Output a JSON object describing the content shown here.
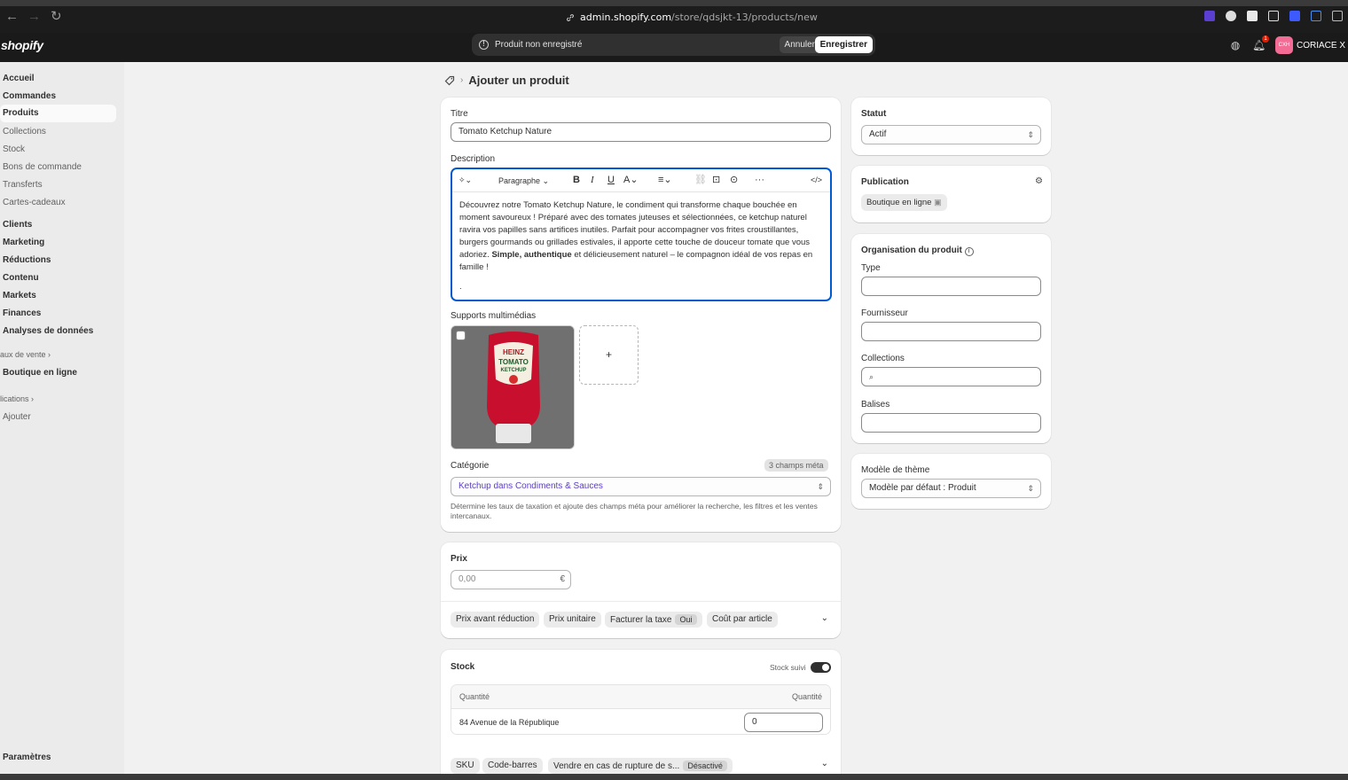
{
  "browser": {
    "url_host": "admin.shopify.com",
    "url_path": "/store/qdsjkt-13/products/new"
  },
  "topbar": {
    "logo": "shopify",
    "unsaved_text": "Produit non enregistré",
    "cancel_label": "Annuler",
    "save_label": "Enregistrer",
    "notification_count": "1",
    "store_initials": "CXH",
    "store_name": "CORIACE X H"
  },
  "sidebar": {
    "items": [
      {
        "label": "Accueil"
      },
      {
        "label": "Commandes"
      },
      {
        "label": "Produits"
      },
      {
        "label": "Collections"
      },
      {
        "label": "Stock"
      },
      {
        "label": "Bons de commande"
      },
      {
        "label": "Transferts"
      },
      {
        "label": "Cartes-cadeaux"
      },
      {
        "label": "Clients"
      },
      {
        "label": "Marketing"
      },
      {
        "label": "Réductions"
      },
      {
        "label": "Contenu"
      },
      {
        "label": "Markets"
      },
      {
        "label": "Finances"
      },
      {
        "label": "Analyses de données"
      }
    ],
    "sales_channels_label": "aux de vente",
    "online_store": "Boutique en ligne",
    "apps_label": "lications",
    "add_label": "Ajouter",
    "settings": "Paramètres"
  },
  "page": {
    "title": "Ajouter un produit",
    "title_label": "Titre",
    "title_value": "Tomato Ketchup Nature",
    "description_label": "Description",
    "paragraph_select": "Paragraphe",
    "description": {
      "part1": "Découvrez notre Tomato Ketchup Nature, le condiment qui transforme chaque bouchée en moment savoureux ! Préparé avec des tomates juteuses et sélectionnées, ce ketchup naturel ravira vos papilles sans artifices inutiles. Parfait pour accompagner vos frites croustillantes, burgers gourmands ou grillades estivales, il apporte cette touche de douceur tomate que vous adoriez. ",
      "bold": "Simple, authentique",
      "part2": " et délicieusement naturel – le compagnon idéal de vos repas en famille !",
      "trailing": "."
    },
    "media_label": "Supports multimédias",
    "bottle_texts": {
      "brand": "HEINZ",
      "line1": "TOMATO",
      "line2": "KETCHUP"
    },
    "add_media": "+",
    "category_label": "Catégorie",
    "category_badge": "3 champs méta",
    "category_value_main": "Ketchup",
    "category_value_rest": " dans Condiments & Sauces",
    "category_help": "Détermine les taux de taxation et ajoute des champs méta pour améliorer la recherche, les filtres et les ventes intercanaux.",
    "price_label": "Prix",
    "price_placeholder": "0,00",
    "currency": "€",
    "price_pills": [
      "Prix avant réduction",
      "Prix unitaire",
      "Facturer la taxe",
      "Coût par article"
    ],
    "tax_badge": "Oui",
    "stock_label": "Stock",
    "stock_tracked": "Stock suivi",
    "stock_tracked_on": true,
    "qty_header_left": "Quantité",
    "qty_header_right": "Quantité",
    "location": "84 Avenue de la République",
    "location_qty": "0",
    "stock_pills": [
      "SKU",
      "Code-barres",
      "Vendre en cas de rupture de s..."
    ],
    "oos_badge": "Désactivé"
  },
  "right": {
    "status_label": "Statut",
    "status_value": "Actif",
    "publication_label": "Publication",
    "publication_channel": "Boutique en ligne",
    "org_label": "Organisation du produit",
    "type_label": "Type",
    "vendor_label": "Fournisseur",
    "collections_label": "Collections",
    "tags_label": "Balises",
    "theme_label": "Modèle de thème",
    "theme_value": "Modèle par défaut : Produit"
  },
  "colors": {
    "accent": "#005bd3",
    "category_link": "#5c3fbf",
    "bottle": "#c8102e"
  }
}
